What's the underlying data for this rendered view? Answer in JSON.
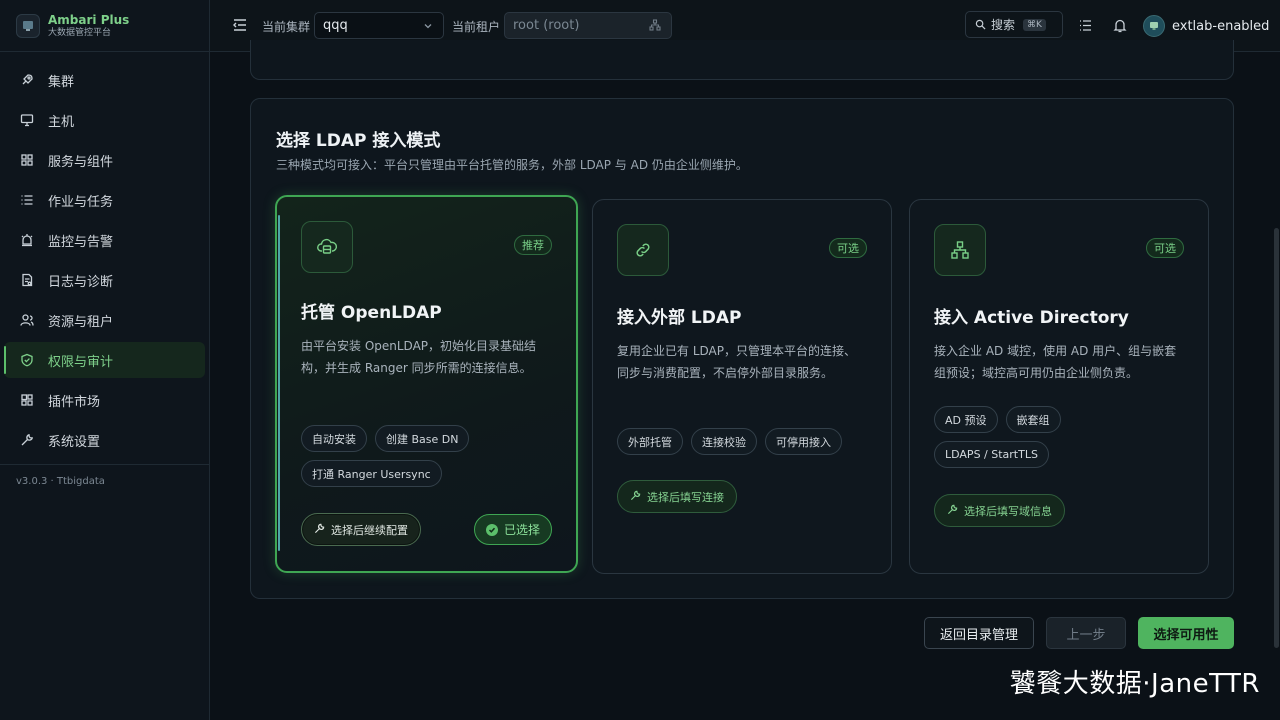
{
  "brand": {
    "title": "Ambari Plus",
    "subtitle": "大数据管控平台"
  },
  "sidebar": {
    "items": [
      {
        "label": "集群",
        "icon": "rocket-icon"
      },
      {
        "label": "主机",
        "icon": "monitor-icon"
      },
      {
        "label": "服务与组件",
        "icon": "grid-icon"
      },
      {
        "label": "作业与任务",
        "icon": "list-icon"
      },
      {
        "label": "监控与告警",
        "icon": "alarm-icon"
      },
      {
        "label": "日志与诊断",
        "icon": "log-icon"
      },
      {
        "label": "资源与租户",
        "icon": "users-icon"
      },
      {
        "label": "权限与审计",
        "icon": "shield-icon",
        "active": true
      },
      {
        "label": "插件市场",
        "icon": "puzzle-icon"
      },
      {
        "label": "系统设置",
        "icon": "wrench-icon"
      }
    ],
    "version": "v3.0.3 · Ttbigdata"
  },
  "topbar": {
    "cluster_label": "当前集群",
    "cluster_value": "qqq",
    "tenant_label": "当前租户",
    "tenant_value": "root (root)",
    "search_label": "搜索",
    "search_shortcut": "⌘K",
    "username": "extlab-enabled"
  },
  "panel": {
    "title": "选择 LDAP 接入模式",
    "description": "三种模式均可接入：平台只管理由平台托管的服务，外部 LDAP 与 AD 仍由企业侧维护。",
    "cards": [
      {
        "badge": "推荐",
        "title": "托管 OpenLDAP",
        "description": "由平台安装 OpenLDAP，初始化目录基础结构，并生成 Ranger 同步所需的连接信息。",
        "tags": [
          "自动安装",
          "创建 Base DN",
          "打通 Ranger Usersync"
        ],
        "action": "选择后继续配置",
        "selected_label": "已选择"
      },
      {
        "badge": "可选",
        "title": "接入外部 LDAP",
        "description": "复用企业已有 LDAP，只管理本平台的连接、同步与消费配置，不启停外部目录服务。",
        "tags": [
          "外部托管",
          "连接校验",
          "可停用接入"
        ],
        "action": "选择后填写连接"
      },
      {
        "badge": "可选",
        "title": "接入 Active Directory",
        "description": "接入企业 AD 域控，使用 AD 用户、组与嵌套组预设；域控高可用仍由企业侧负责。",
        "tags": [
          "AD 预设",
          "嵌套组",
          "LDAPS / StartTLS"
        ],
        "action": "选择后填写域信息"
      }
    ]
  },
  "footer": {
    "back_label": "返回目录管理",
    "prev_label": "上一步",
    "next_label": "选择可用性"
  },
  "watermark": "饕餮大数据·JaneTTR",
  "colors": {
    "accent": "#4fb45f",
    "background": "#0b1117"
  }
}
